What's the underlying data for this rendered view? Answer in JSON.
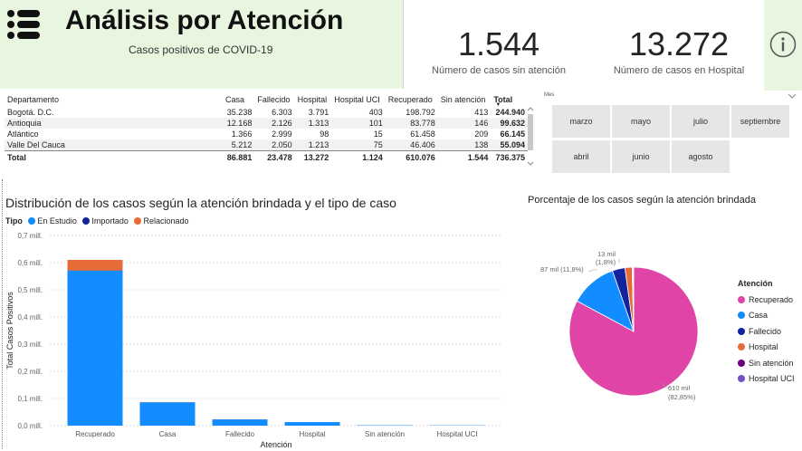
{
  "header": {
    "title": "Análisis por Atención",
    "subtitle": "Casos positivos de COVID-19",
    "menu_icon": "hamburger-menu-icon",
    "info_icon": "info-icon"
  },
  "kpis": [
    {
      "value": "1.544",
      "label": "Número de casos sin atención"
    },
    {
      "value": "13.272",
      "label": "Número de casos en Hospital"
    }
  ],
  "table": {
    "columns": [
      "Departamento",
      "Casa",
      "Fallecido",
      "Hospital",
      "Hospital UCI",
      "Recuperado",
      "Sin atención",
      "Total"
    ],
    "rows": [
      [
        "Bogotá. D.C.",
        "35.238",
        "6.303",
        "3.791",
        "403",
        "198.792",
        "413",
        "244.940"
      ],
      [
        "Antioquia",
        "12.168",
        "2.126",
        "1.313",
        "101",
        "83.778",
        "146",
        "99.632"
      ],
      [
        "Atlántico",
        "1.366",
        "2.999",
        "98",
        "15",
        "61.458",
        "209",
        "66.145"
      ],
      [
        "Valle Del Cauca",
        "5.212",
        "2.050",
        "1.213",
        "75",
        "46.406",
        "138",
        "55.094"
      ]
    ],
    "total": [
      "Total",
      "86.881",
      "23.478",
      "13.272",
      "1.124",
      "610.076",
      "1.544",
      "736.375"
    ]
  },
  "slicer": {
    "label": "Mes",
    "months_row1": [
      "marzo",
      "mayo",
      "julio",
      "septiembre"
    ],
    "months_row2": [
      "abril",
      "junio",
      "agosto"
    ]
  },
  "bar_chart": {
    "title": "Distribución de los casos según la atención brindada y el tipo de caso",
    "legend_title": "Tipo",
    "legend": [
      {
        "name": "En Estudio",
        "color": "#118dff"
      },
      {
        "name": "Importado",
        "color": "#12239e"
      },
      {
        "name": "Relacionado",
        "color": "#e66c37"
      }
    ],
    "ylabel": "Total Casos Positivos",
    "xlabel": "Atención",
    "ticks": [
      "0,0 mill.",
      "0,1 mill.",
      "0,2 mill.",
      "0,3 mill.",
      "0,4 mill.",
      "0,5 mill.",
      "0,6 mill.",
      "0,7 mill."
    ]
  },
  "pie_chart": {
    "title": "Porcentaje de los casos según la atención brindada",
    "legend_title": "Atención",
    "labels": [
      {
        "text1": "610 mil",
        "text2": "(82,85%)"
      },
      {
        "text1": "87 mil (11,8%)"
      },
      {
        "text1": "13 mil",
        "text2": "(1,8%)"
      }
    ]
  },
  "chart_data": [
    {
      "type": "bar",
      "title": "Distribución de los casos según la atención brindada y el tipo de caso",
      "categories": [
        "Recuperado",
        "Casa",
        "Fallecido",
        "Hospital",
        "Sin atención",
        "Hospital UCI"
      ],
      "series": [
        {
          "name": "En Estudio",
          "color": "#118dff",
          "values": [
            570000,
            86000,
            23000,
            13000,
            1500,
            1100
          ]
        },
        {
          "name": "Importado",
          "color": "#12239e",
          "values": [
            1000,
            200,
            100,
            50,
            10,
            5
          ]
        },
        {
          "name": "Relacionado",
          "color": "#e66c37",
          "values": [
            39000,
            700,
            400,
            200,
            30,
            20
          ]
        }
      ],
      "stacked": true,
      "xlabel": "Atención",
      "ylabel": "Total Casos Positivos",
      "ylim": [
        0,
        700000
      ],
      "grid": true,
      "legend": "top-left"
    },
    {
      "type": "pie",
      "title": "Porcentaje de los casos según la atención brindada",
      "categories": [
        "Recuperado",
        "Casa",
        "Fallecido",
        "Hospital",
        "Sin atención",
        "Hospital UCI"
      ],
      "values": [
        610076,
        86881,
        23478,
        13272,
        1544,
        1124
      ],
      "colors": [
        "#e044a7",
        "#118dff",
        "#12239e",
        "#e66c37",
        "#6b007b",
        "#744ec2"
      ],
      "legend": "right"
    }
  ]
}
